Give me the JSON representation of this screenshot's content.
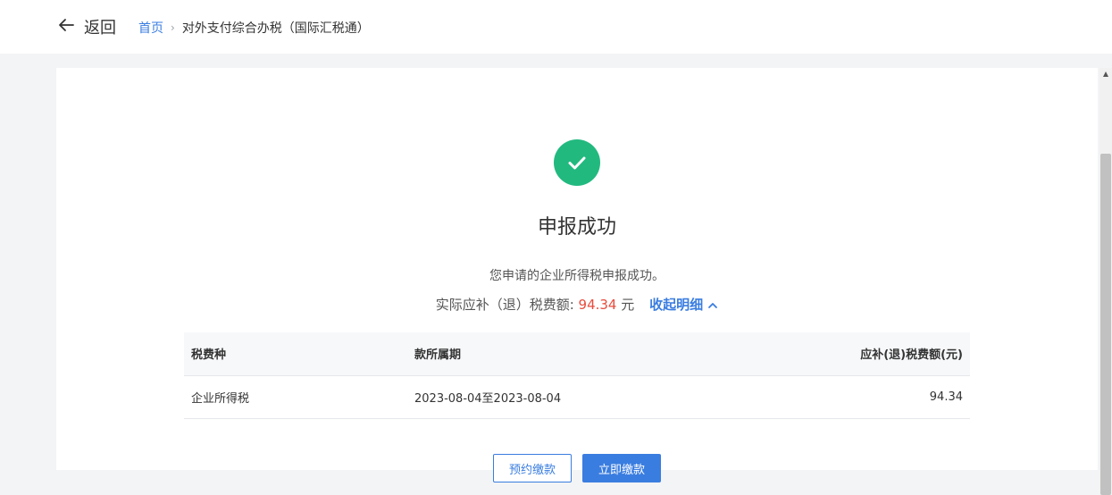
{
  "header": {
    "back_label": "返回",
    "breadcrumb": {
      "home": "首页",
      "separator": "›",
      "current": "对外支付综合办税（国际汇税通）"
    }
  },
  "result": {
    "icon": "check-circle-icon",
    "title": "申报成功",
    "description": "您申请的企业所得税申报成功。",
    "amount_label": "实际应补（退）税费额:",
    "amount_value": "94.34",
    "amount_unit": "元",
    "toggle_label": "收起明细",
    "toggle_icon": "chevron-up-icon"
  },
  "table": {
    "columns": [
      "税费种",
      "款所属期",
      "应补(退)税费额(元)"
    ],
    "rows": [
      [
        "企业所得税",
        "2023-08-04至2023-08-04",
        "94.34"
      ]
    ]
  },
  "actions": {
    "reserve_label": "预约缴款",
    "pay_label": "立即缴款"
  },
  "colors": {
    "accent": "#3a7de0",
    "success": "#22b97f",
    "amount": "#e84c3d"
  }
}
